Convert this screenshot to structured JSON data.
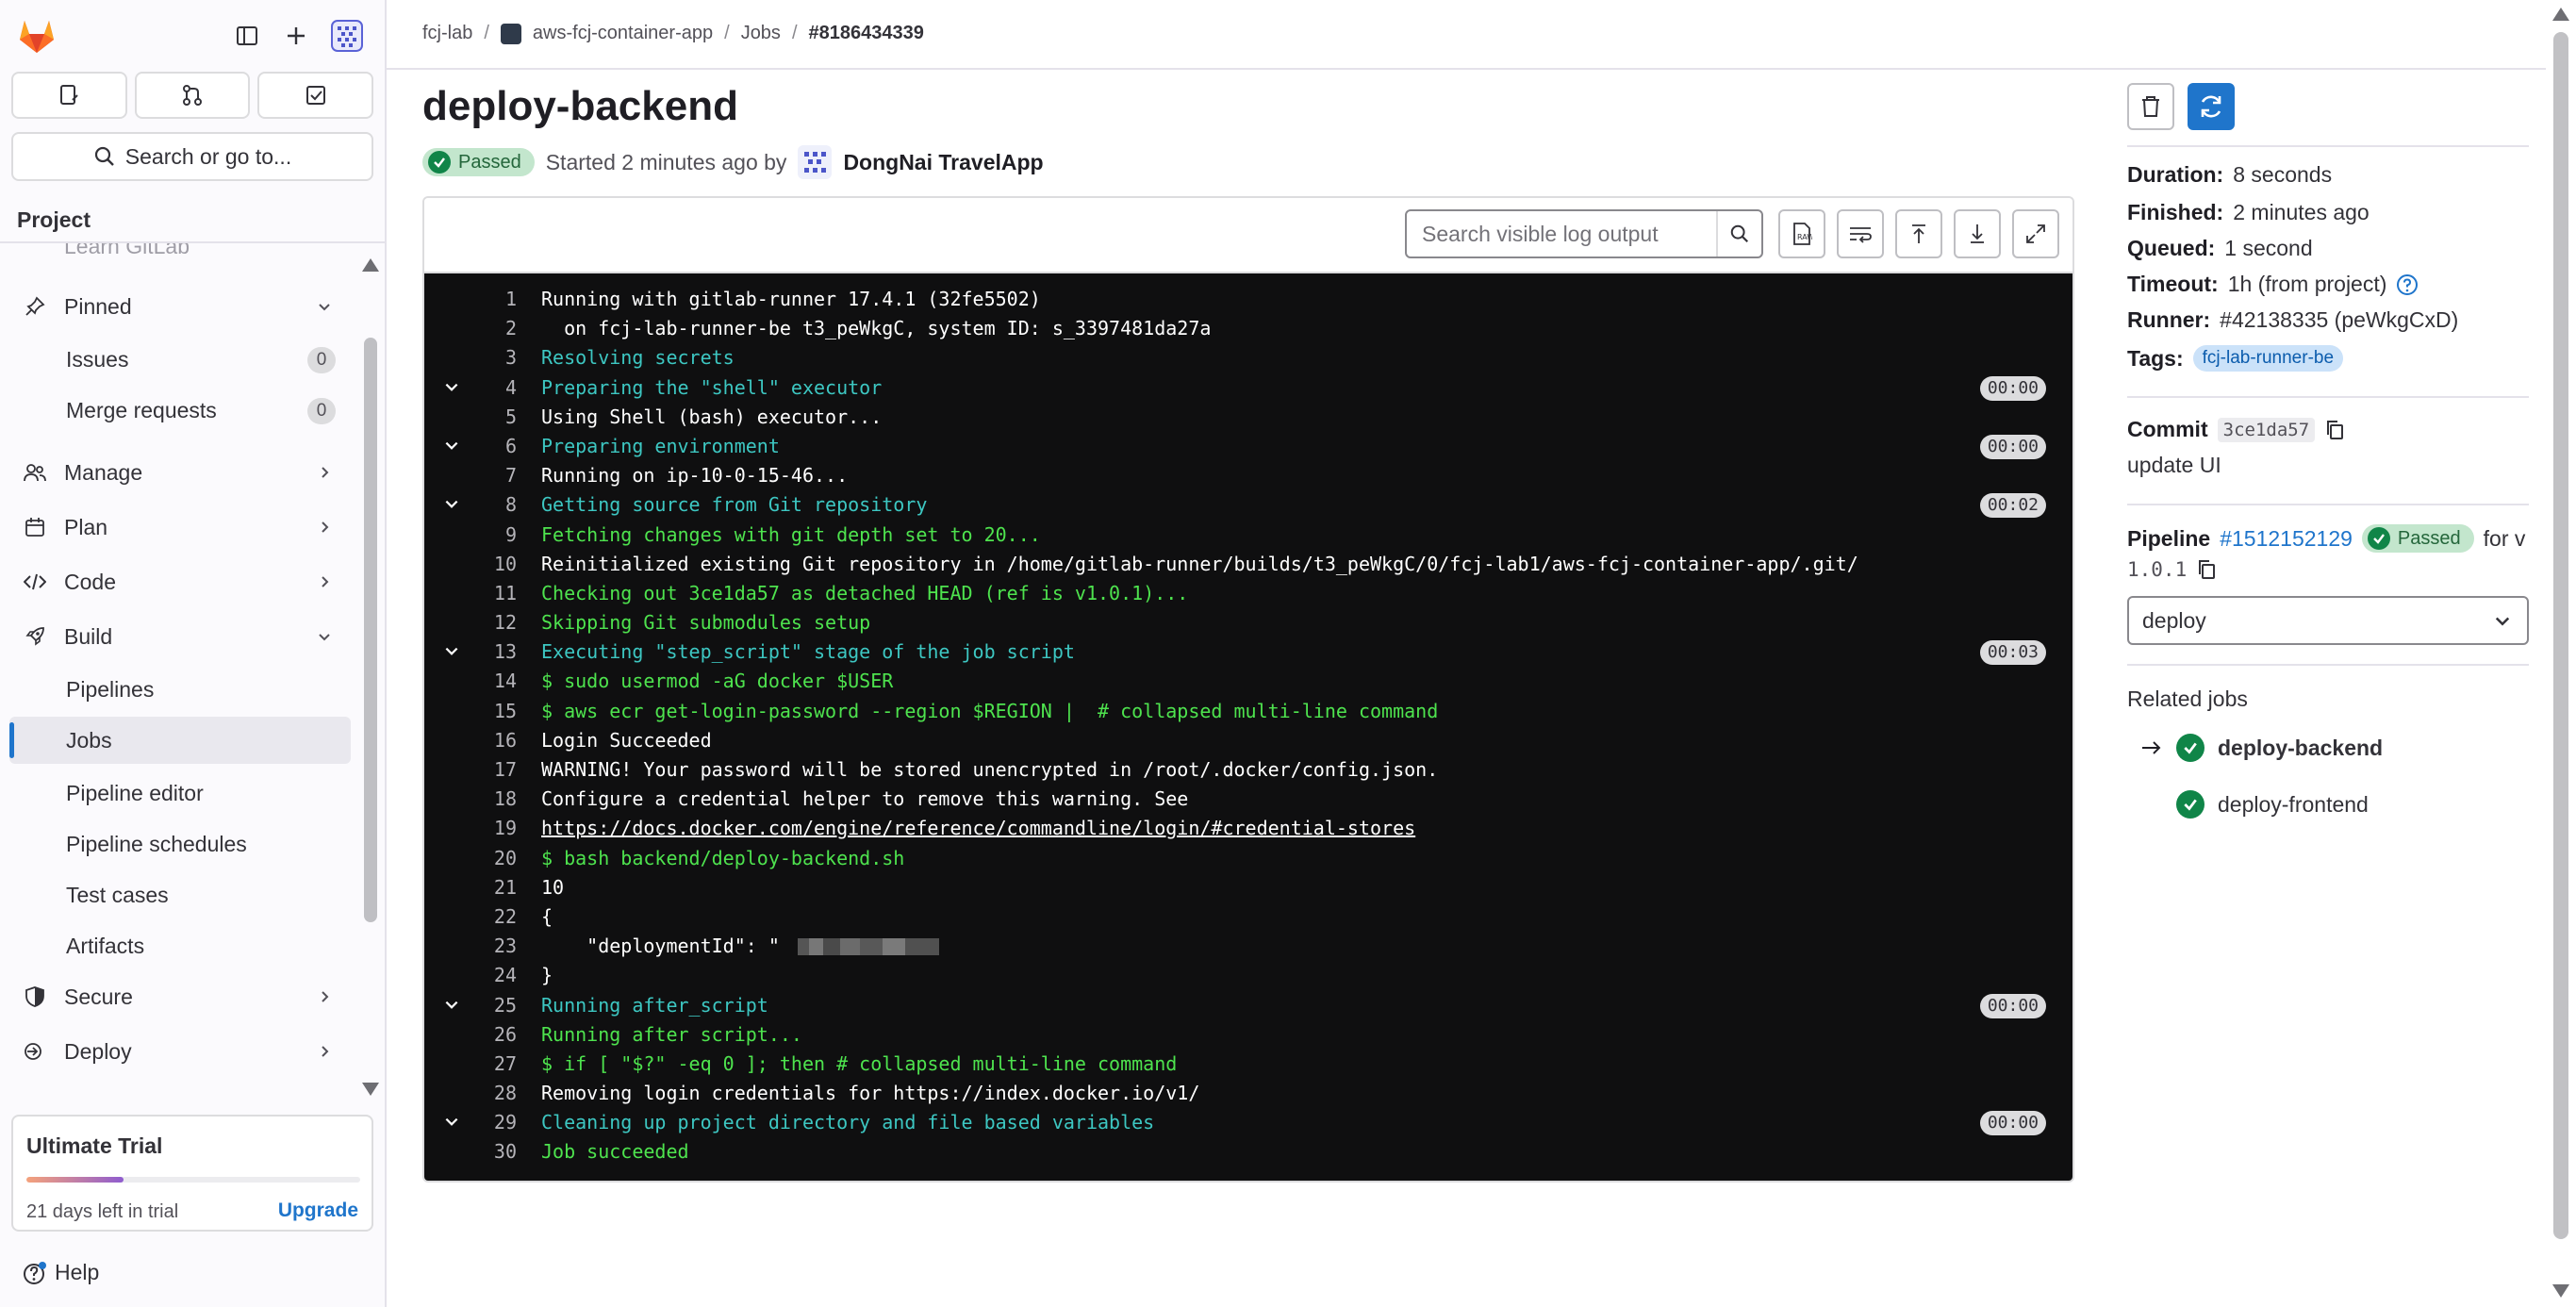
{
  "breadcrumb": {
    "group": "fcj-lab",
    "project": "aws-fcj-container-app",
    "section": "Jobs",
    "current": "#8186434339"
  },
  "sidebar": {
    "search_label": "Search or go to...",
    "section_title": "Project",
    "faded_item": "Learn GitLab",
    "pinned": {
      "label": "Pinned",
      "items": [
        {
          "label": "Issues",
          "count": "0"
        },
        {
          "label": "Merge requests",
          "count": "0"
        }
      ]
    },
    "groups": [
      {
        "label": "Manage",
        "icon": "users-icon"
      },
      {
        "label": "Plan",
        "icon": "calendar-icon"
      },
      {
        "label": "Code",
        "icon": "code-icon"
      },
      {
        "label": "Build",
        "icon": "rocket-icon"
      }
    ],
    "build_items": [
      "Pipelines",
      "Jobs",
      "Pipeline editor",
      "Pipeline schedules",
      "Test cases",
      "Artifacts"
    ],
    "after_groups": [
      {
        "label": "Secure",
        "icon": "shield-icon"
      },
      {
        "label": "Deploy",
        "icon": "deploy-icon"
      }
    ],
    "trial": {
      "title": "Ultimate Trial",
      "days_left": "21 days left in trial",
      "upgrade": "Upgrade",
      "progress": 0.29
    },
    "help": "Help"
  },
  "job": {
    "title": "deploy-backend",
    "status": "Passed",
    "started": "Started 2 minutes ago by",
    "user": "DongNai TravelApp"
  },
  "log": {
    "search_placeholder": "Search visible log output",
    "lines": [
      {
        "n": "1",
        "text": "Running with gitlab-runner 17.4.1 (32fe5502)",
        "color": "white"
      },
      {
        "n": "2",
        "text": "  on fcj-lab-runner-be t3_peWkgC, system ID: s_3397481da27a",
        "color": "white"
      },
      {
        "n": "3",
        "text": "Resolving secrets",
        "color": "cyan"
      },
      {
        "n": "4",
        "text": "Preparing the \"shell\" executor",
        "color": "cyan",
        "section": true,
        "dur": "00:00"
      },
      {
        "n": "5",
        "text": "Using Shell (bash) executor...",
        "color": "white"
      },
      {
        "n": "6",
        "text": "Preparing environment",
        "color": "cyan",
        "section": true,
        "dur": "00:00"
      },
      {
        "n": "7",
        "text": "Running on ip-10-0-15-46...",
        "color": "white"
      },
      {
        "n": "8",
        "text": "Getting source from Git repository",
        "color": "cyan",
        "section": true,
        "dur": "00:02"
      },
      {
        "n": "9",
        "text": "Fetching changes with git depth set to 20...",
        "color": "green"
      },
      {
        "n": "10",
        "text": "Reinitialized existing Git repository in /home/gitlab-runner/builds/t3_peWkgC/0/fcj-lab1/aws-fcj-container-app/.git/",
        "color": "white"
      },
      {
        "n": "11",
        "text": "Checking out 3ce1da57 as detached HEAD (ref is v1.0.1)...",
        "color": "green"
      },
      {
        "n": "12",
        "text": "Skipping Git submodules setup",
        "color": "green"
      },
      {
        "n": "13",
        "text": "Executing \"step_script\" stage of the job script",
        "color": "cyan",
        "section": true,
        "dur": "00:03"
      },
      {
        "n": "14",
        "text": "$ sudo usermod -aG docker $USER",
        "color": "green"
      },
      {
        "n": "15",
        "text": "$ aws ecr get-login-password --region $REGION |  # collapsed multi-line command",
        "color": "green"
      },
      {
        "n": "16",
        "text": "Login Succeeded",
        "color": "white"
      },
      {
        "n": "17",
        "text": "WARNING! Your password will be stored unencrypted in /root/.docker/config.json.",
        "color": "white"
      },
      {
        "n": "18",
        "text": "Configure a credential helper to remove this warning. See",
        "color": "white"
      },
      {
        "n": "19",
        "text": "https://docs.docker.com/engine/reference/commandline/login/#credential-stores",
        "color": "white",
        "link": true
      },
      {
        "n": "20",
        "text": "$ bash backend/deploy-backend.sh",
        "color": "green"
      },
      {
        "n": "21",
        "text": "10",
        "color": "white"
      },
      {
        "n": "22",
        "text": "{",
        "color": "white"
      },
      {
        "n": "23",
        "text": "    \"deploymentId\": \"",
        "color": "white",
        "redacted": true
      },
      {
        "n": "24",
        "text": "}",
        "color": "white"
      },
      {
        "n": "25",
        "text": "Running after_script",
        "color": "cyan",
        "section": true,
        "dur": "00:00"
      },
      {
        "n": "26",
        "text": "Running after script...",
        "color": "green"
      },
      {
        "n": "27",
        "text": "$ if [ \"$?\" -eq 0 ]; then # collapsed multi-line command",
        "color": "green"
      },
      {
        "n": "28",
        "text": "Removing login credentials for https://index.docker.io/v1/",
        "color": "white"
      },
      {
        "n": "29",
        "text": "Cleaning up project directory and file based variables",
        "color": "cyan",
        "section": true,
        "dur": "00:00"
      },
      {
        "n": "30",
        "text": "Job succeeded",
        "color": "green"
      }
    ]
  },
  "details": {
    "duration_label": "Duration:",
    "duration": "8 seconds",
    "finished_label": "Finished:",
    "finished": "2 minutes ago",
    "queued_label": "Queued:",
    "queued": "1 second",
    "timeout_label": "Timeout:",
    "timeout": "1h (from project)",
    "runner_label": "Runner:",
    "runner": "#42138335 (peWkgCxD)",
    "tags_label": "Tags:",
    "tag": "fcj-lab-runner-be",
    "commit_label": "Commit",
    "commit_sha": "3ce1da57",
    "commit_msg": "update UI",
    "pipeline_label": "Pipeline",
    "pipeline_id": "#1512152129",
    "pipeline_status": "Passed",
    "pipeline_for": "for v",
    "pipeline_ref": "1.0.1",
    "stage_select": "deploy",
    "related_title": "Related jobs",
    "related_jobs": [
      "deploy-backend",
      "deploy-frontend"
    ]
  },
  "colors": {
    "link": "#1f75cb",
    "success": "#108548",
    "log_bg": "#0f0f10",
    "log_cyan": "#3dc7c2",
    "log_green": "#4ee34e"
  }
}
